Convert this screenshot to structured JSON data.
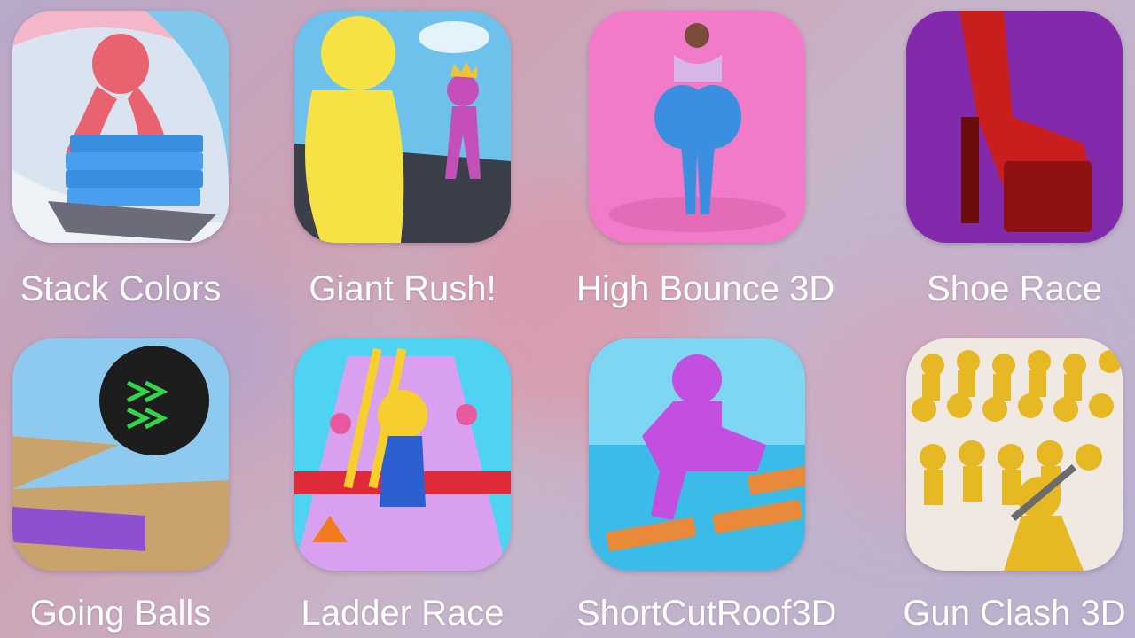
{
  "apps": [
    {
      "name": "Stack Colors",
      "icon": "stack-colors-icon"
    },
    {
      "name": "Giant Rush!",
      "icon": "giant-rush-icon"
    },
    {
      "name": "High Bounce 3D",
      "icon": "high-bounce-3d-icon"
    },
    {
      "name": "Shoe Race",
      "icon": "shoe-race-icon"
    },
    {
      "name": "Going Balls",
      "icon": "going-balls-icon"
    },
    {
      "name": "Ladder Race",
      "icon": "ladder-race-icon"
    },
    {
      "name": "ShortCutRoof3D",
      "icon": "short-cut-roof-3d-icon"
    },
    {
      "name": "Gun Clash 3D",
      "icon": "gun-clash-3d-icon"
    }
  ],
  "colors": {
    "label": "#ffffff",
    "background_mid": "#cda2b4"
  }
}
